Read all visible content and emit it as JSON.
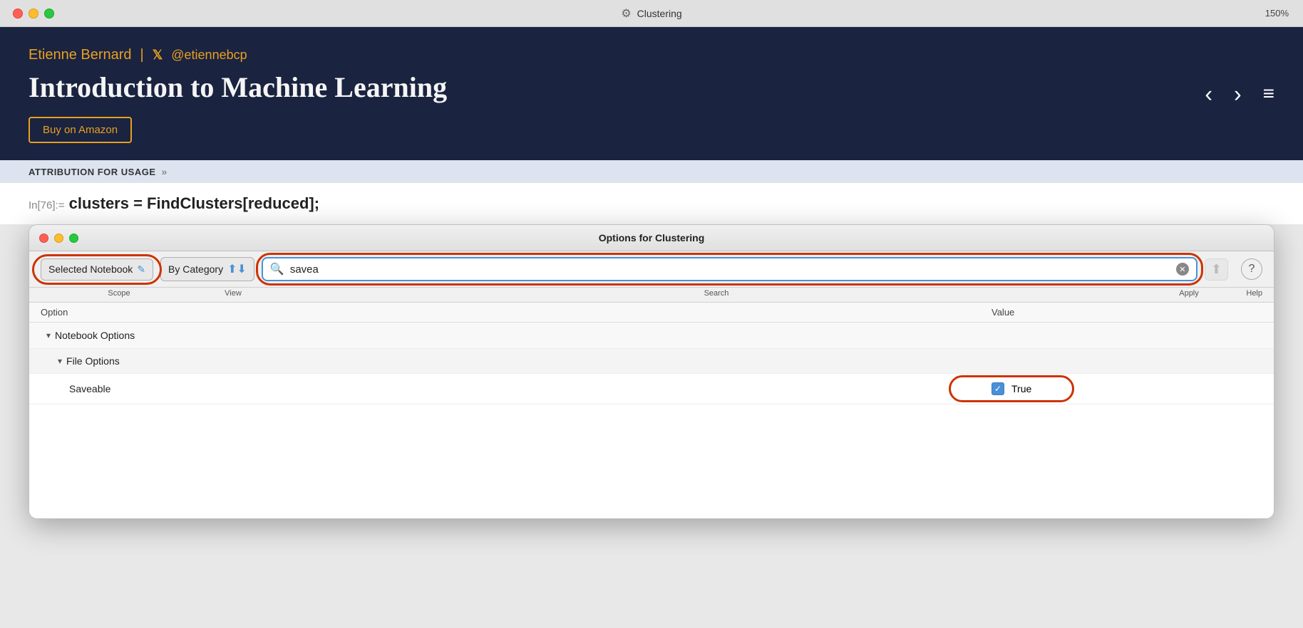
{
  "titlebar": {
    "title": "Clustering",
    "zoom": "150%"
  },
  "header": {
    "author": "Etienne Bernard",
    "divider": "|",
    "x_handle": "@etiennebcp",
    "book_title": "Introduction to Machine Learning",
    "buy_button": "Buy on Amazon",
    "nav_left": "‹",
    "nav_right": "›"
  },
  "attribution": {
    "label": "ATTRIBUTION FOR USAGE",
    "arrow": "»"
  },
  "code": {
    "prompt": "In[76]:=",
    "content": "clusters = FindClusters[reduced];"
  },
  "dialog": {
    "title": "Options for Clustering",
    "toolbar": {
      "scope_label": "Selected Notebook",
      "view_label": "By Category",
      "search_value": "savea",
      "search_placeholder": "Search",
      "scope_col": "Scope",
      "view_col": "View",
      "search_col": "Search",
      "apply_col": "Apply",
      "help_col": "Help",
      "help_char": "?"
    },
    "table": {
      "col_option": "Option",
      "col_value": "Value",
      "group": "Notebook Options",
      "subgroup": "File Options",
      "rows": [
        {
          "option": "Saveable",
          "value": "True",
          "checked": true
        }
      ]
    }
  }
}
